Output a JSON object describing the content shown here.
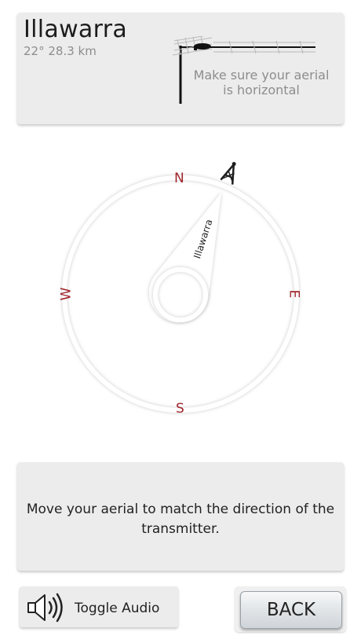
{
  "header": {
    "station_name": "Illawarra",
    "station_details": "22° 28.3 km",
    "aerial_hint": "Make sure your aerial is horizontal"
  },
  "compass": {
    "north": "N",
    "south": "S",
    "east": "E",
    "west": "W",
    "transmitter_label": "Illawarra",
    "cardinal_color": "#a0272d"
  },
  "message": {
    "text": "Move your aerial to match the direction of the transmitter."
  },
  "footer": {
    "audio_label": "Toggle Audio",
    "back_label": "BACK"
  },
  "icons": {
    "aerial": "tv-aerial-icon",
    "transmitter": "transmitter-tower-icon",
    "speaker": "speaker-icon"
  }
}
